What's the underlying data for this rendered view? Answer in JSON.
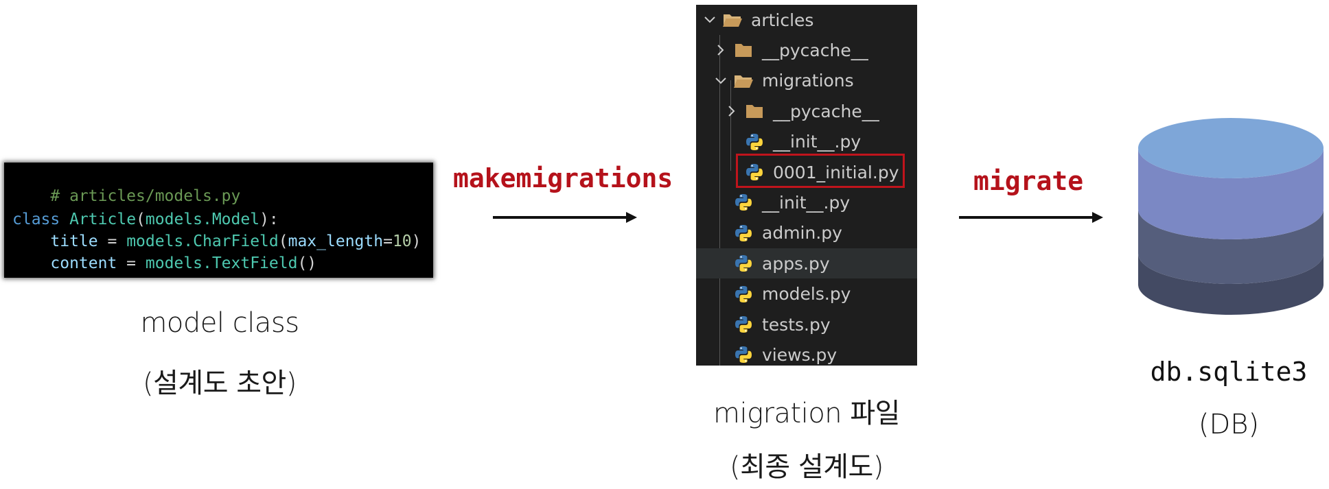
{
  "code": {
    "comment": "# articles/models.py",
    "class_kw": "class",
    "class_name": "Article",
    "paren_open": "(",
    "base_class": "models.Model",
    "paren_close": "):",
    "indent": "    ",
    "title_var": "title",
    "eq": " = ",
    "models_prefix": "models.",
    "charfield": "CharField",
    "charfield_open": "(",
    "max_length_kw": "max_length",
    "eq2": "=",
    "max_length_val": "10",
    "charfield_close": ")",
    "content_var": "content",
    "textfield": "TextField",
    "textfield_args": "()"
  },
  "model_caption": {
    "line1": "model class",
    "line2": "(설계도 초안)"
  },
  "makemigrations_label": "makemigrations",
  "migrate_label": "migrate",
  "tree": {
    "items": [
      {
        "label": "articles",
        "type": "folder-open"
      },
      {
        "label": "__pycache__",
        "type": "folder"
      },
      {
        "label": "migrations",
        "type": "folder-open"
      },
      {
        "label": "__pycache__",
        "type": "folder"
      },
      {
        "label": "__init__.py",
        "type": "python"
      },
      {
        "label": "0001_initial.py",
        "type": "python",
        "highlighted": true
      },
      {
        "label": "__init__.py",
        "type": "python"
      },
      {
        "label": "admin.py",
        "type": "python"
      },
      {
        "label": "apps.py",
        "type": "python",
        "selected": true
      },
      {
        "label": "models.py",
        "type": "python"
      },
      {
        "label": "tests.py",
        "type": "python"
      },
      {
        "label": "views.py",
        "type": "python"
      }
    ]
  },
  "migration_caption": {
    "line1": "migration 파일",
    "line2": "(최종 설계도)"
  },
  "db_caption": {
    "name": "db.sqlite3",
    "type": "(DB)"
  },
  "colors": {
    "accent_red": "#b5121b",
    "db_top": "#7ea6d8",
    "db_mid": "#7b88c4",
    "db_lower": "#555e7c",
    "db_bottom": "#434a63"
  }
}
